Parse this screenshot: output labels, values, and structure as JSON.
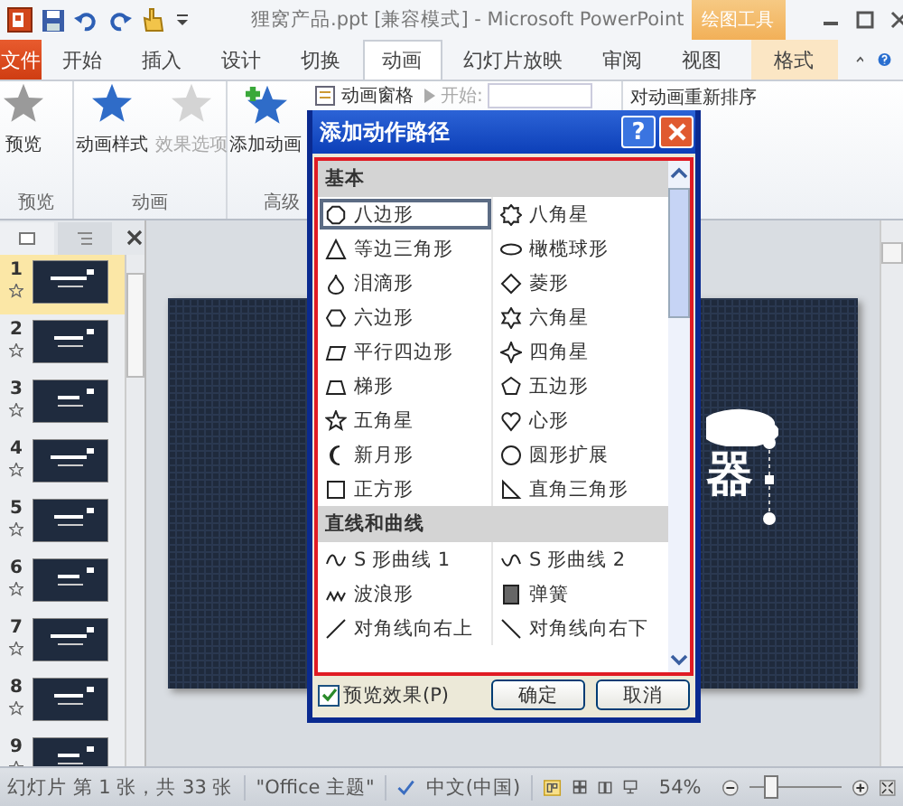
{
  "window": {
    "title": "狸窝产品.ppt [兼容模式] - Microsoft PowerPoint",
    "context_group": "绘图工具"
  },
  "tabs": [
    {
      "label": "文件",
      "kind": "file",
      "selected": false
    },
    {
      "label": "开始",
      "kind": "tab",
      "selected": false
    },
    {
      "label": "插入",
      "kind": "tab",
      "selected": false
    },
    {
      "label": "设计",
      "kind": "tab",
      "selected": false
    },
    {
      "label": "切换",
      "kind": "tab",
      "selected": false
    },
    {
      "label": "动画",
      "kind": "tab",
      "selected": true
    },
    {
      "label": "幻灯片放映",
      "kind": "tab",
      "selected": false
    },
    {
      "label": "审阅",
      "kind": "tab",
      "selected": false
    },
    {
      "label": "视图",
      "kind": "tab",
      "selected": false
    },
    {
      "label": "格式",
      "kind": "context",
      "selected": false
    }
  ],
  "ribbon": {
    "preview_group": {
      "label": "预览",
      "button": "预览"
    },
    "animation_group": {
      "label": "动画",
      "buttons": [
        {
          "label": "动画样式",
          "disabled": false
        },
        {
          "label": "效果选项",
          "disabled": true
        }
      ]
    },
    "advanced_group": {
      "label": "高级",
      "add_button": "添加动画",
      "pane_button": "动画窗格",
      "start_label": "开始:"
    },
    "reorder_label": "对动画重新排序"
  },
  "slides": [
    {
      "number": "1",
      "selected": true
    },
    {
      "number": "2",
      "selected": false
    },
    {
      "number": "3",
      "selected": false
    },
    {
      "number": "4",
      "selected": false
    },
    {
      "number": "5",
      "selected": false
    },
    {
      "number": "6",
      "selected": false
    },
    {
      "number": "7",
      "selected": false
    },
    {
      "number": "8",
      "selected": false
    },
    {
      "number": "9",
      "selected": false
    }
  ],
  "slide_text": "器",
  "dialog": {
    "title": "添加动作路径",
    "help": "?",
    "sections": [
      {
        "heading": "基本",
        "items": [
          {
            "label": "八边形",
            "selected": true
          },
          {
            "label": "八角星",
            "selected": false
          },
          {
            "label": "等边三角形",
            "selected": false
          },
          {
            "label": "橄榄球形",
            "selected": false
          },
          {
            "label": "泪滴形",
            "selected": false
          },
          {
            "label": "菱形",
            "selected": false
          },
          {
            "label": "六边形",
            "selected": false
          },
          {
            "label": "六角星",
            "selected": false
          },
          {
            "label": "平行四边形",
            "selected": false
          },
          {
            "label": "四角星",
            "selected": false
          },
          {
            "label": "梯形",
            "selected": false
          },
          {
            "label": "五边形",
            "selected": false
          },
          {
            "label": "五角星",
            "selected": false
          },
          {
            "label": "心形",
            "selected": false
          },
          {
            "label": "新月形",
            "selected": false
          },
          {
            "label": "圆形扩展",
            "selected": false
          },
          {
            "label": "正方形",
            "selected": false
          },
          {
            "label": "直角三角形",
            "selected": false
          }
        ]
      },
      {
        "heading": "直线和曲线",
        "items": [
          {
            "label": "S 形曲线 1",
            "selected": false
          },
          {
            "label": "S 形曲线 2",
            "selected": false
          },
          {
            "label": "波浪形",
            "selected": false
          },
          {
            "label": "弹簧",
            "selected": false
          },
          {
            "label": "对角线向右上",
            "selected": false
          },
          {
            "label": "对角线向右下",
            "selected": false
          }
        ]
      }
    ],
    "preview": {
      "label": "预览效果(P)",
      "checked": true
    },
    "buttons": [
      "确定",
      "取消"
    ]
  },
  "status_bar": {
    "slide_info": "幻灯片 第 1 张，共 33 张",
    "theme": "\"Office 主题\"",
    "language": "中文(中国)",
    "zoom": "54%",
    "zoom_slider": {
      "level": 0.22
    }
  }
}
